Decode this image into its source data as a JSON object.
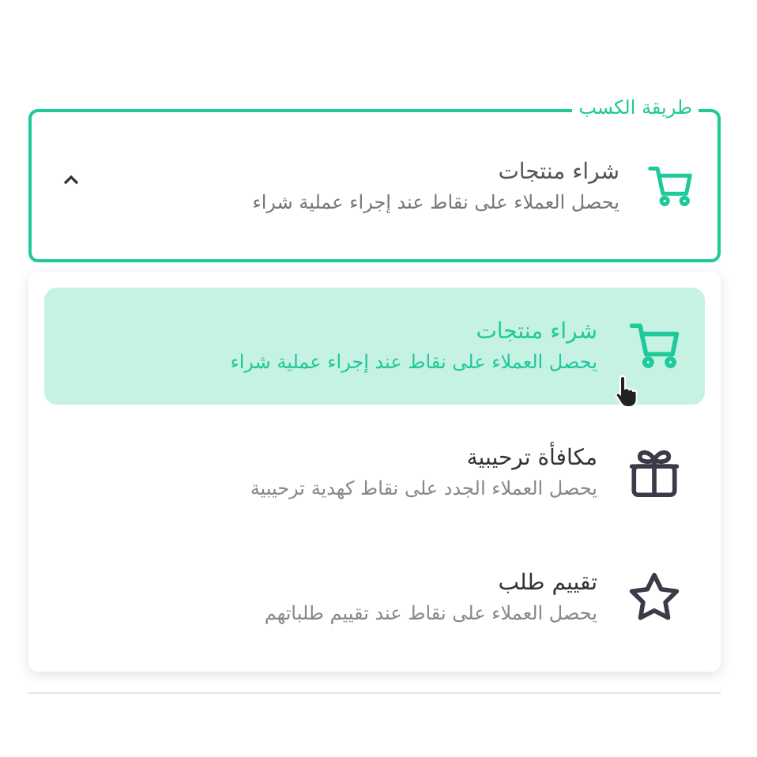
{
  "field": {
    "legend": "طريقة الكسب",
    "expanded": true,
    "kind": "cart",
    "title": "شراء منتجات",
    "description": "يحصل العملاء على نقاط عند إجراء عملية شراء"
  },
  "options": [
    {
      "kind": "cart",
      "title": "شراء منتجات",
      "description": "يحصل العملاء على نقاط عند إجراء عملية شراء",
      "selected": true
    },
    {
      "kind": "gift",
      "title": "مكافأة ترحيبية",
      "description": "يحصل العملاء الجدد على نقاط كهدية ترحيبية",
      "selected": false
    },
    {
      "kind": "star",
      "title": "تقييم طلب",
      "description": "يحصل العملاء على نقاط عند تقييم طلباتهم",
      "selected": false
    }
  ]
}
